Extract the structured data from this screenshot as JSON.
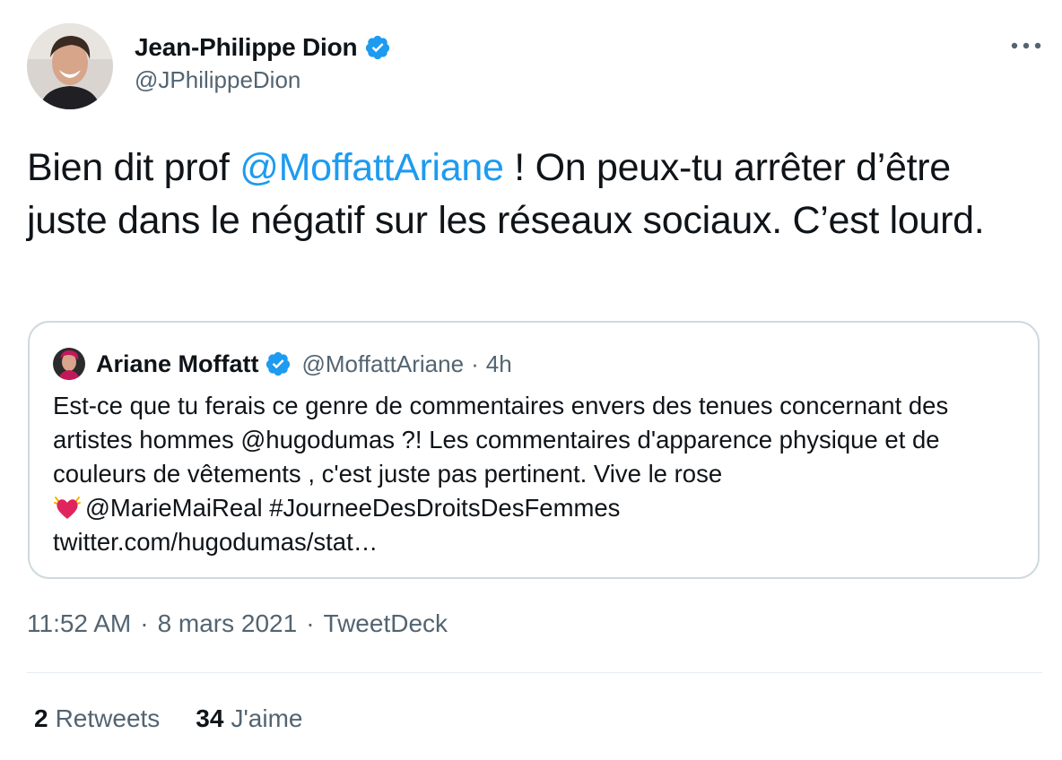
{
  "tweet": {
    "author": {
      "display_name": "Jean-Philippe Dion",
      "handle": "@JPhilippeDion",
      "verified_icon": "verified-badge-icon",
      "avatar_icon": "profile-photo"
    },
    "more_icon": "more-horizontal-icon",
    "text": {
      "part1": "Bien dit prof ",
      "mention": "@MoffattAriane",
      "part2": " ! On peux-tu arrêter d’être juste dans le négatif sur les réseaux sociaux. C’est lourd."
    },
    "quote": {
      "display_name": "Ariane Moffatt",
      "handle": "@MoffattAriane",
      "dot": "·",
      "time": "4h",
      "body_line1": "Est-ce que tu ferais ce genre de commentaires envers des tenues concernant des artistes hommes @hugodumas ?! Les commentaires d'apparence physique et de couleurs de vêtements , c'est juste  pas pertinent. Vive le rose",
      "body_line2": "@MarieMaiReal #JourneeDesDroitsDesFemmes",
      "body_line3": "twitter.com/hugodumas/stat…",
      "heart_icon": "growing-heart-emoji"
    },
    "meta": {
      "time": "11:52 AM",
      "sep": "·",
      "date": "8 mars 2021",
      "source": "TweetDeck"
    },
    "stats": {
      "retweets_count": "2",
      "retweets_label": "Retweets",
      "likes_count": "34",
      "likes_label": "J'aime"
    },
    "colors": {
      "link": "#1d9bf0",
      "secondary_text": "#536471",
      "border": "#cfd9de",
      "verified": "#1d9bf0"
    }
  }
}
